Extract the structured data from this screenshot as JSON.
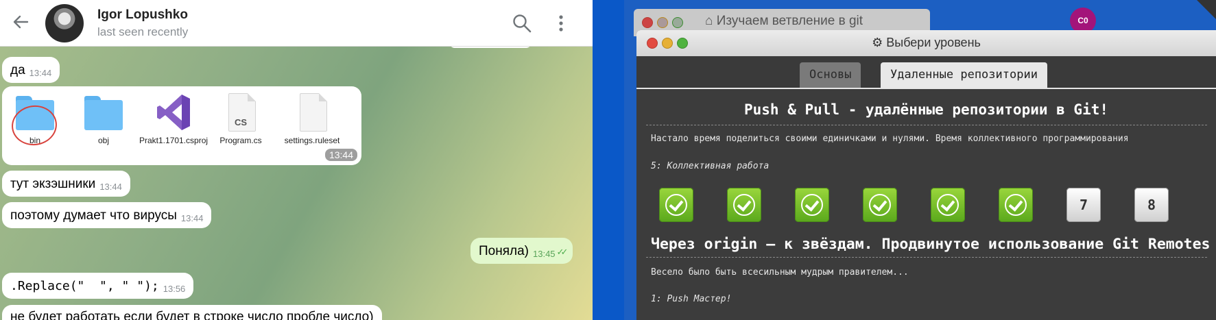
{
  "telegram": {
    "contact_name": "Igor Lopushko",
    "contact_status": "last seen recently",
    "messages": [
      {
        "text": "да",
        "time": "13:44"
      },
      {
        "text": "тут экзэшники",
        "time": "13:44"
      },
      {
        "text": "поэтому думает что вирусы",
        "time": "13:44"
      },
      {
        "text": "Поняла)",
        "time": "13:45"
      },
      {
        "text": ".Replace(\"  \", \" \");",
        "time": "13:56"
      },
      {
        "text": "не будет работать если будет в строке число пробле число)",
        "time": ""
      }
    ],
    "files_time": "13:44",
    "files": [
      {
        "name": "bin",
        "icon": "folder-icon"
      },
      {
        "name": "obj",
        "icon": "folder-icon"
      },
      {
        "name": "Prakt1.1701.csproj",
        "icon": "visual-studio-icon"
      },
      {
        "name": "Program.cs",
        "icon": "cs-file-icon"
      },
      {
        "name": "settings.ruleset",
        "icon": "file-icon"
      }
    ],
    "cs_label": "CS"
  },
  "desktop": {
    "back_window_title": "Изучаем ветвление в git",
    "user_badge": "C0",
    "window_title": "Выбери уровень",
    "tabs": [
      {
        "label": "Основы"
      },
      {
        "label": "Удаленные репозитории"
      }
    ],
    "section1": {
      "title": "Push & Pull - удалённые репозитории в Git!",
      "description": "Настало время поделиться своими единичками и нулями. Время коллективного программирования",
      "current_level": "5: Коллективная работа",
      "levels": [
        {
          "num": "1",
          "done": true
        },
        {
          "num": "2",
          "done": true
        },
        {
          "num": "3",
          "done": true
        },
        {
          "num": "4",
          "done": true
        },
        {
          "num": "5",
          "done": true
        },
        {
          "num": "6",
          "done": true
        },
        {
          "num": "7",
          "done": false
        },
        {
          "num": "8",
          "done": false
        }
      ]
    },
    "section2": {
      "title": "Через origin – к звёздам. Продвинутое использование Git Remotes",
      "description": "Весело было быть всесильным мудрым правителем...",
      "current_level": "1: Push Мастер!"
    }
  }
}
